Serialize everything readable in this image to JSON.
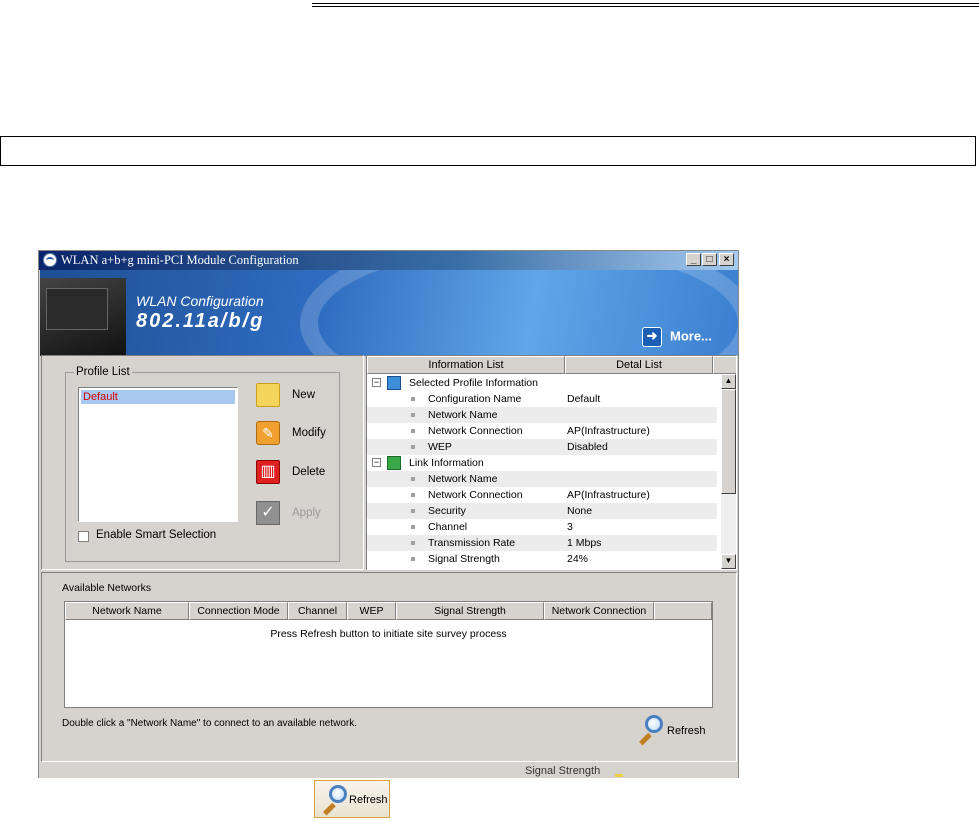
{
  "window": {
    "title": "WLAN a+b+g mini-PCI Module Configuration"
  },
  "banner": {
    "line1": "WLAN Configuration",
    "line2": "802.11a/b/g",
    "more_label": "More..."
  },
  "profile_list": {
    "group_label": "Profile List",
    "items": [
      "Default"
    ],
    "enable_smart_selection_label": "Enable Smart Selection",
    "buttons": {
      "new": "New",
      "modify": "Modify",
      "delete": "Delete",
      "apply": "Apply"
    }
  },
  "info": {
    "tabs": [
      "Information List",
      "Detal List"
    ],
    "groups": [
      {
        "title": "Selected Profile Information",
        "rows": [
          {
            "key": "Configuration Name",
            "value": "Default"
          },
          {
            "key": "Network Name",
            "value": ""
          },
          {
            "key": "Network Connection",
            "value": "AP(Infrastructure)"
          },
          {
            "key": "WEP",
            "value": "Disabled"
          }
        ]
      },
      {
        "title": "Link Information",
        "rows": [
          {
            "key": "Network Name",
            "value": ""
          },
          {
            "key": "Network Connection",
            "value": "AP(Infrastructure)"
          },
          {
            "key": "Security",
            "value": "None"
          },
          {
            "key": "Channel",
            "value": "3"
          },
          {
            "key": "Transmission Rate",
            "value": "1 Mbps"
          },
          {
            "key": "Signal Strength",
            "value": "24%"
          }
        ]
      }
    ]
  },
  "available": {
    "title": "Available Networks",
    "columns": [
      "Network Name",
      "Connection Mode",
      "Channel",
      "WEP",
      "Signal Strength",
      "Network Connection"
    ],
    "hint": "Press Refresh button to initiate site survey process",
    "double_click_hint": "Double click a \"Network Name\" to connect to an available network.",
    "refresh_label": "Refresh"
  },
  "status": {
    "signal_label": "Signal Strength"
  },
  "standalone_refresh_label": "Refresh"
}
